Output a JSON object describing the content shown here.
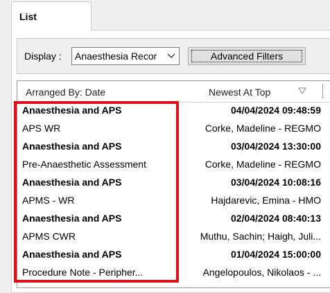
{
  "tab": {
    "label": "List"
  },
  "filters": {
    "display_label": "Display :",
    "display_value": "Anaesthesia Recor",
    "advanced_label": "Advanced Filters"
  },
  "list": {
    "header_left": "Arranged By: Date",
    "header_right": "Newest At Top",
    "rows": [
      {
        "c1": "Anaesthesia and APS",
        "c2": "04/04/2024 09:48:59",
        "bold": true
      },
      {
        "c1": "APS WR",
        "c2": "Corke, Madeline  - REGMO",
        "bold": false
      },
      {
        "c1": "Anaesthesia and APS",
        "c2": "03/04/2024 13:30:00",
        "bold": true
      },
      {
        "c1": "Pre-Anaesthetic Assessment",
        "c2": "Corke, Madeline  - REGMO",
        "bold": false
      },
      {
        "c1": "Anaesthesia and APS",
        "c2": "03/04/2024 10:08:16",
        "bold": true
      },
      {
        "c1": "APMS - WR",
        "c2": "Hajdarevic, Emina  - HMO",
        "bold": false
      },
      {
        "c1": "Anaesthesia and APS",
        "c2": "02/04/2024 08:40:13",
        "bold": true
      },
      {
        "c1": "APMS CWR",
        "c2": "Muthu, Sachin; Haigh, Juli...",
        "bold": false
      },
      {
        "c1": "Anaesthesia and APS",
        "c2": "01/04/2024 15:00:00",
        "bold": true
      },
      {
        "c1": "Procedure Note - Peripher...",
        "c2": "Angelopoulos, Nikolaos  - ...",
        "bold": false
      }
    ]
  },
  "colors": {
    "highlight": "#e0101a"
  }
}
